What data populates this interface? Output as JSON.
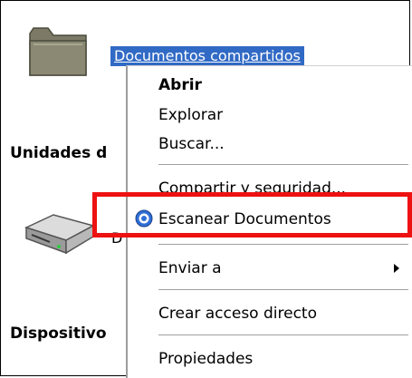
{
  "explorer": {
    "folder_name": "Documentos compartidos",
    "heading_drives": "Unidades d",
    "drive_label_fragment": "D",
    "heading_devices": "Dispositivo"
  },
  "context_menu": {
    "items": [
      {
        "label": "Abrir"
      },
      {
        "label": "Explorar"
      },
      {
        "label": "Buscar..."
      },
      {
        "label": "Compartir y seguridad..."
      },
      {
        "label": "Escanear Documentos",
        "icon": "scan-icon"
      },
      {
        "label": "Enviar a",
        "submenu_arrow": "chevron-right-icon"
      },
      {
        "label": "Crear acceso directo"
      },
      {
        "label": "Propiedades"
      }
    ]
  },
  "colors": {
    "selection": "#316ac5",
    "highlight_box": "#ee1111"
  }
}
